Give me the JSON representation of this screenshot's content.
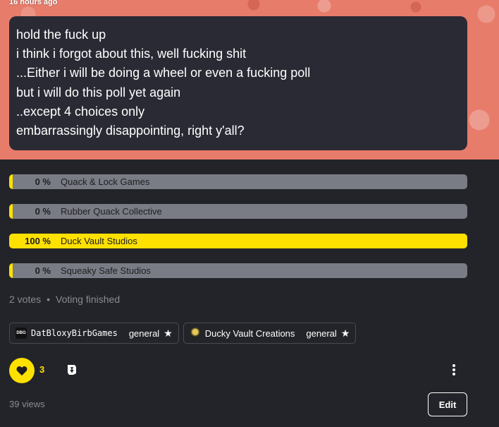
{
  "post": {
    "timestamp": "16 hours ago",
    "lines": [
      "hold the fuck up",
      "i think i forgot about this, well fucking shit",
      "...Either i will be doing a wheel or even a fucking poll",
      "but i will do this poll yet again",
      "..except 4 choices only",
      "embarrassingly disappointing, right y'all?"
    ],
    "banner_color": "#e77c6a"
  },
  "poll": {
    "options": [
      {
        "percent_label": "0 %",
        "label": "Quack & Lock Games",
        "share": 0
      },
      {
        "percent_label": "0 %",
        "label": "Rubber Quack Collective",
        "share": 0
      },
      {
        "percent_label": "100 %",
        "label": "Duck Vault Studios",
        "share": 100
      },
      {
        "percent_label": "0 %",
        "label": "Squeaky Safe Studios",
        "share": 0
      }
    ],
    "votes": "2 votes",
    "status": "Voting finished",
    "fill_color": "#ffe100",
    "track_color": "#7a7c85"
  },
  "tags": [
    {
      "name": "DatBloxyBirbGames",
      "logo_text": "DBG",
      "category": "general",
      "icon": "star-icon"
    },
    {
      "name": "Ducky Vault Creations",
      "logo_text": "",
      "category": "general",
      "icon": "star-icon"
    }
  ],
  "actions": {
    "like_count": "3",
    "like_icon": "heart-icon",
    "share_icon": "share-icon",
    "more_icon": "more-vertical-icon",
    "views": "39 views",
    "edit_label": "Edit"
  }
}
